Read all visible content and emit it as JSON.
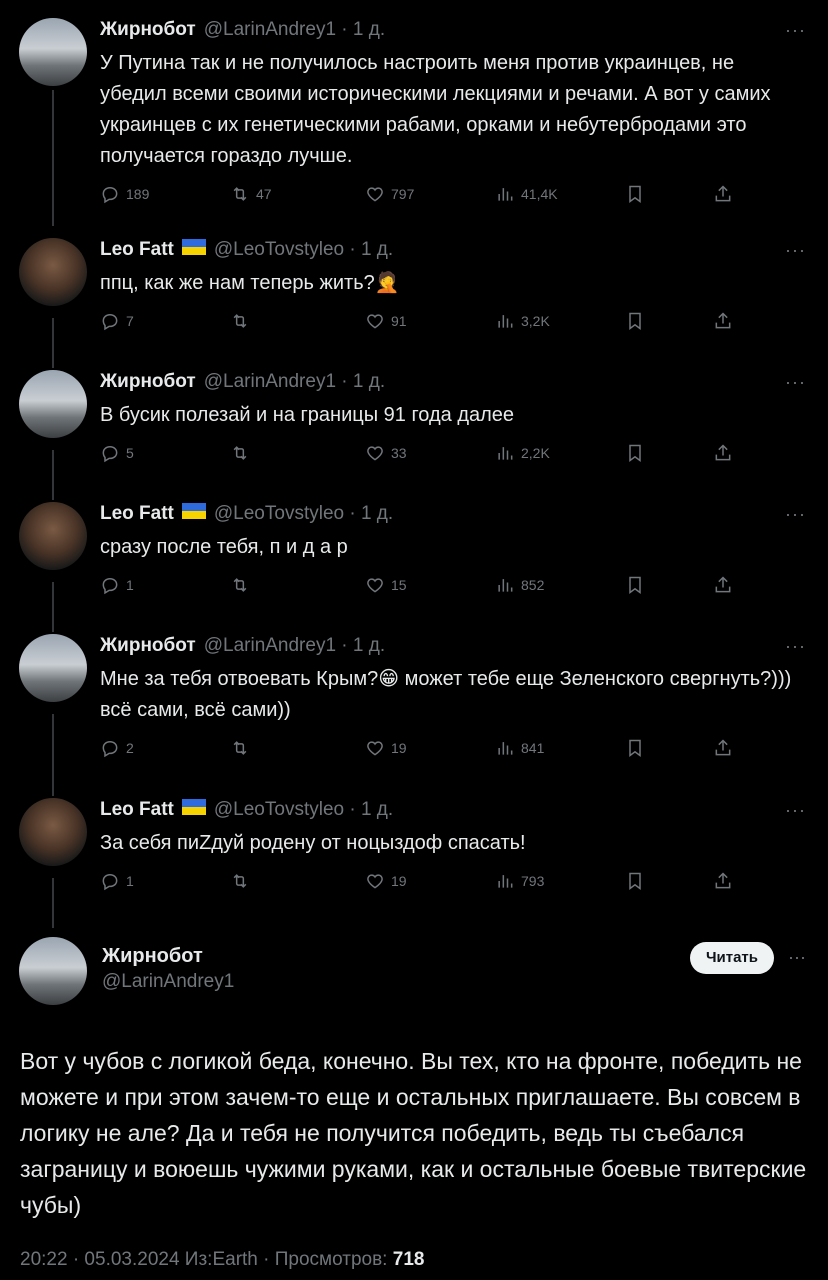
{
  "replies": [
    {
      "author": "Жирнобот",
      "handle": "@LarinAndrey1",
      "time": "1 д.",
      "flag": false,
      "text": "У Путина так и не получилось настроить меня против украинцев, не убедил всеми своими историческими лекциями и речами. А вот у самих украинцев с их генетическими рабами, орками и небутербродами это получается гораздо лучше.",
      "replies": "189",
      "retweets": "47",
      "likes": "797",
      "views": "41,4K"
    },
    {
      "author": "Leo Fatt",
      "handle": "@LeoTovstyleo",
      "time": "1 д.",
      "flag": true,
      "text": "ппц, как же нам теперь жить?🤦",
      "replies": "7",
      "retweets": "",
      "likes": "91",
      "views": "3,2K"
    },
    {
      "author": "Жирнобот",
      "handle": "@LarinAndrey1",
      "time": "1 д.",
      "flag": false,
      "text": "В бусик полезай и на границы 91 года далее",
      "replies": "5",
      "retweets": "",
      "likes": "33",
      "views": "2,2K"
    },
    {
      "author": "Leo Fatt",
      "handle": "@LeoTovstyleo",
      "time": "1 д.",
      "flag": true,
      "text": "сразу после тебя, п и д а р",
      "replies": "1",
      "retweets": "",
      "likes": "15",
      "views": "852"
    },
    {
      "author": "Жирнобот",
      "handle": "@LarinAndrey1",
      "time": "1 д.",
      "flag": false,
      "text": "Мне за тебя отвоевать Крым?😁 может тебе еще Зеленского свергнуть?))) всё сами, всё сами))",
      "replies": "2",
      "retweets": "",
      "likes": "19",
      "views": "841"
    },
    {
      "author": "Leo Fatt",
      "handle": "@LeoTovstyleo",
      "time": "1 д.",
      "flag": true,
      "text": "За себя пиZдуй родену от ноцыздоф спасать!",
      "replies": "1",
      "retweets": "",
      "likes": "19",
      "views": "793"
    }
  ],
  "main": {
    "author": "Жирнобот",
    "handle": "@LarinAndrey1",
    "follow_label": "Читать",
    "text": "Вот у чубов с логикой беда, конечно. Вы тех, кто на фронте, победить не можете и при этом зачем-то еще и остальных приглашаете. Вы совсем в логику не але? Да и тебя не получится победить, ведь ты съебался заграницу и воюешь чужими руками, как и остальные боевые твитерские чубы)",
    "meta": "20:22 · 05.03.2024 Из:Earth · Просмотров:",
    "views": "718"
  },
  "ui": {
    "more": "···",
    "dot": "·"
  },
  "colors": {
    "bg": "#000000",
    "text": "#e7e9ea",
    "muted": "#71767b",
    "line": "#333639"
  },
  "icons": [
    "reply-icon",
    "retweet-icon",
    "like-icon",
    "views-icon",
    "bookmark-icon",
    "share-icon"
  ]
}
